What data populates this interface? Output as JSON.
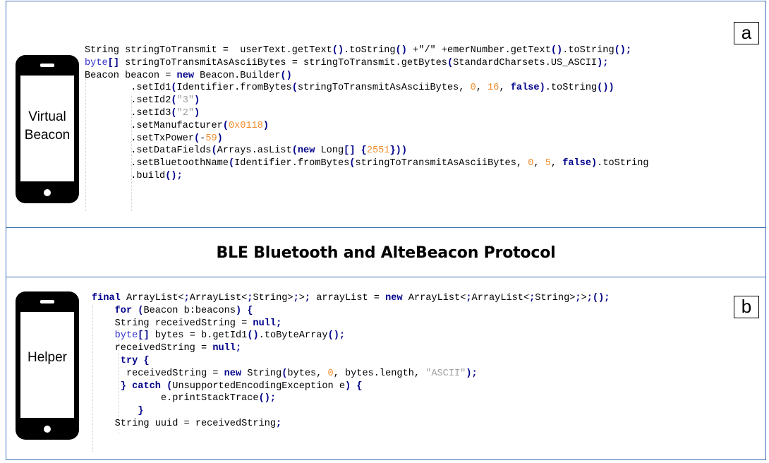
{
  "panel_a": {
    "label": "a",
    "device_label_line1": "Virtual",
    "device_label_line2": "Beacon",
    "code": [
      "String stringToTransmit =  userText.getText().toString() +\"/\" +emerNumber.getText().toString();",
      "byte[] stringToTransmitAsAsciiBytes = stringToTransmit.getBytes(StandardCharsets.US_ASCII);",
      "Beacon beacon = new Beacon.Builder()",
      "        .setId1(Identifier.fromBytes(stringToTransmitAsAsciiBytes, 0, 16, false).toString())",
      "        .setId2(\"3\")",
      "        .setId3(\"2\")",
      "        .setManufacturer(0x0118)",
      "        .setTxPower(-59)",
      "        .setDataFields(Arrays.asList(new Long[] {2551}))",
      "        .setBluetoothName(Identifier.fromBytes(stringToTransmitAsAsciiBytes, 0, 5, false).toString",
      "        .build();"
    ]
  },
  "title": "BLE Bluetooth and AlteBeacon Protocol",
  "panel_b": {
    "label": "b",
    "device_label": "Helper",
    "code": [
      "final ArrayList<ArrayList<String>> arrayList = new ArrayList<ArrayList<String>>();",
      "    for (Beacon b:beacons) {",
      "    String receivedString = null;",
      "    byte[] bytes = b.getId1().toByteArray();",
      "    receivedString = null;",
      "     try {",
      "      receivedString = new String(bytes, 0, bytes.length, \"ASCII\");",
      "     } catch (UnsupportedEncodingException e) {",
      "            e.printStackTrace();",
      "        }",
      "    String uuid = receivedString;"
    ]
  },
  "colors": {
    "border": "#3a6fb5",
    "keyword": "#00008b",
    "number": "#f08c2c",
    "string_literal": "#a0a0a0"
  },
  "icons": [
    "smartphone-icon",
    "smartphone-icon"
  ]
}
